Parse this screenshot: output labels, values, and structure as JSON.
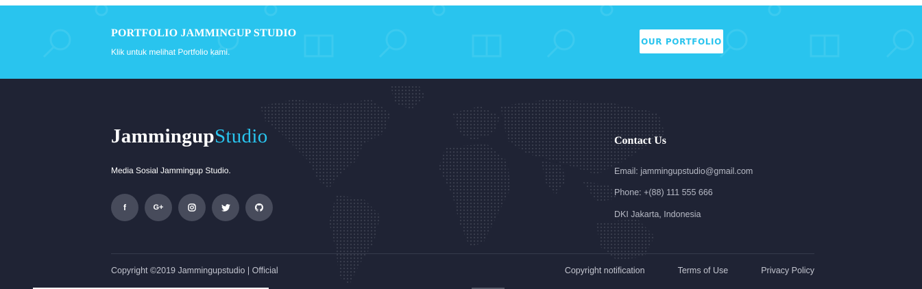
{
  "banner": {
    "title": "PORTFOLIO JAMMINGUP STUDIO",
    "subtitle": "Klik untuk melihat Portfolio kami.",
    "button_label": "OUR PORTFOLIO",
    "background_color": "#29c4ee"
  },
  "footer": {
    "brand_primary": "Jammingup",
    "brand_accent": "Studio",
    "accent_color": "#29c4ee",
    "background_color": "#1f2334",
    "social_description": "Media Sosial Jammingup Studio.",
    "socials": [
      {
        "name": "facebook-icon",
        "glyph": "f"
      },
      {
        "name": "google-plus-icon",
        "glyph": "G+"
      },
      {
        "name": "instagram-icon",
        "glyph": ""
      },
      {
        "name": "twitter-icon",
        "glyph": ""
      },
      {
        "name": "github-icon",
        "glyph": ""
      }
    ],
    "contact": {
      "title": "Contact Us",
      "email": "Email: jammingupstudio@gmail.com",
      "phone": "Phone: +(88) 111 555 666",
      "address": "DKI Jakarta, Indonesia"
    },
    "copyright": "Copyright ©2019 Jammingupstudio | Official",
    "links": [
      "Copyright notification",
      "Terms of Use",
      "Privacy Policy"
    ]
  }
}
